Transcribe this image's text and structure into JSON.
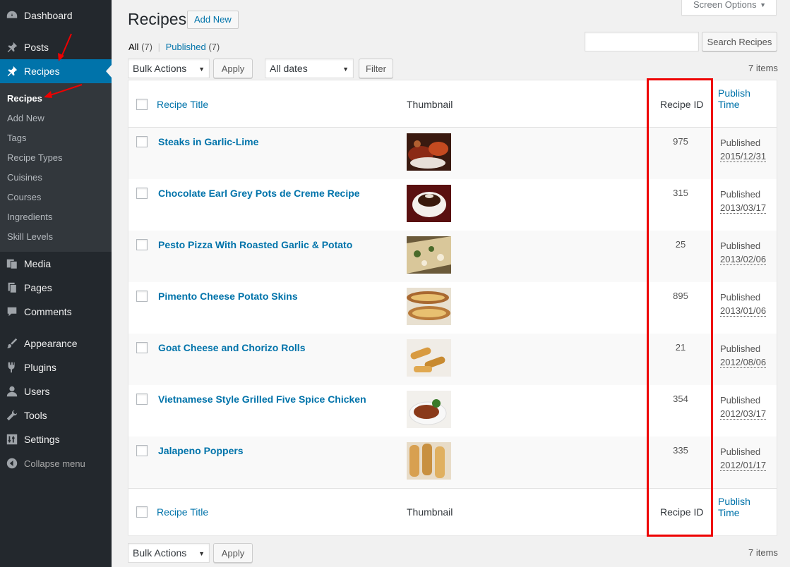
{
  "sidebar": {
    "items": [
      {
        "label": "Dashboard",
        "icon": "dashboard-icon"
      },
      {
        "label": "Posts",
        "icon": "pin-icon"
      },
      {
        "label": "Recipes",
        "icon": "pin-icon"
      },
      {
        "label": "Media",
        "icon": "media-icon"
      },
      {
        "label": "Pages",
        "icon": "pages-icon"
      },
      {
        "label": "Comments",
        "icon": "comment-icon"
      },
      {
        "label": "Appearance",
        "icon": "brush-icon"
      },
      {
        "label": "Plugins",
        "icon": "plug-icon"
      },
      {
        "label": "Users",
        "icon": "user-icon"
      },
      {
        "label": "Tools",
        "icon": "wrench-icon"
      },
      {
        "label": "Settings",
        "icon": "settings-icon"
      }
    ],
    "submenu": [
      "Recipes",
      "Add New",
      "Tags",
      "Recipe Types",
      "Cuisines",
      "Courses",
      "Ingredients",
      "Skill Levels"
    ],
    "collapse_label": "Collapse menu"
  },
  "header": {
    "title": "Recipes",
    "add_new": "Add New",
    "screen_options": "Screen Options"
  },
  "filters": {
    "all_label": "All",
    "all_count": "(7)",
    "separator": "|",
    "published_label": "Published",
    "published_count": "(7)"
  },
  "search": {
    "button": "Search Recipes",
    "value": ""
  },
  "toolbar": {
    "bulk_actions": "Bulk Actions",
    "apply": "Apply",
    "dates": "All dates",
    "filter": "Filter",
    "items_count": "7 items"
  },
  "table": {
    "columns": {
      "title": "Recipe Title",
      "thumbnail": "Thumbnail",
      "recipe_id": "Recipe ID",
      "publish_time_1": "Publish",
      "publish_time_2": "Time"
    },
    "rows": [
      {
        "title": "Steaks in Garlic-Lime",
        "id": "975",
        "status": "Published",
        "date": "2015/12/31"
      },
      {
        "title": "Chocolate Earl Grey Pots de Creme Recipe",
        "id": "315",
        "status": "Published",
        "date": "2013/03/17"
      },
      {
        "title": "Pesto Pizza With Roasted Garlic & Potato",
        "id": "25",
        "status": "Published",
        "date": "2013/02/06"
      },
      {
        "title": "Pimento Cheese Potato Skins",
        "id": "895",
        "status": "Published",
        "date": "2013/01/06"
      },
      {
        "title": "Goat Cheese and Chorizo Rolls",
        "id": "21",
        "status": "Published",
        "date": "2012/08/06"
      },
      {
        "title": "Vietnamese Style Grilled Five Spice Chicken",
        "id": "354",
        "status": "Published",
        "date": "2012/03/17"
      },
      {
        "title": "Jalapeno Poppers",
        "id": "335",
        "status": "Published",
        "date": "2012/01/17"
      }
    ]
  },
  "colors": {
    "sidebar_bg": "#23282d",
    "active": "#0073aa",
    "link": "#0073aa",
    "highlight": "#ee0000"
  }
}
